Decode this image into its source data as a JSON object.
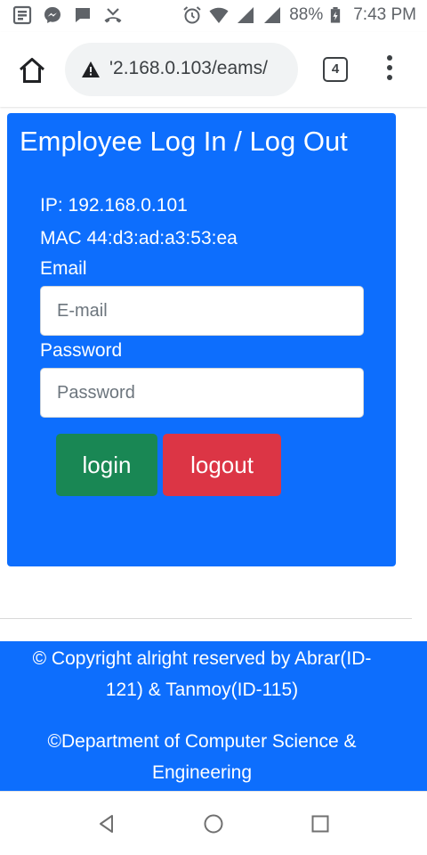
{
  "status_bar": {
    "battery": "88%",
    "time": "7:43 PM"
  },
  "browser": {
    "url": "'2.168.0.103/eams/",
    "tab_count": "4"
  },
  "card": {
    "title": "Employee Log In / Log Out",
    "ip_line": "IP: 192.168.0.101",
    "mac_line": "MAC 44:d3:ad:a3:53:ea",
    "email_label": "Email",
    "email_placeholder": "E-mail",
    "email_value": "",
    "password_label": "Password",
    "password_placeholder": "Password",
    "password_value": "",
    "login_label": "login",
    "logout_label": "logout"
  },
  "footer": {
    "line1": "© Copyright alright reserved by Abrar(ID-",
    "line2": "121) & Tanmoy(ID-115)",
    "line3": "©Department of Computer Science &",
    "line4": "Engineering"
  },
  "colors": {
    "primary": "#0d6efd",
    "success": "#198754",
    "danger": "#dc3545"
  },
  "icons": {
    "status_left": [
      "gallery-icon",
      "messenger-icon",
      "message-icon",
      "missed-call-icon"
    ],
    "status_right": [
      "alarm-icon",
      "wifi-icon",
      "signal-icon",
      "signal-icon",
      "battery-icon"
    ],
    "browser": [
      "home-icon",
      "warning-icon",
      "tabs-icon",
      "more-menu-icon"
    ],
    "nav": [
      "back-icon",
      "home-circle-icon",
      "recents-icon"
    ]
  }
}
